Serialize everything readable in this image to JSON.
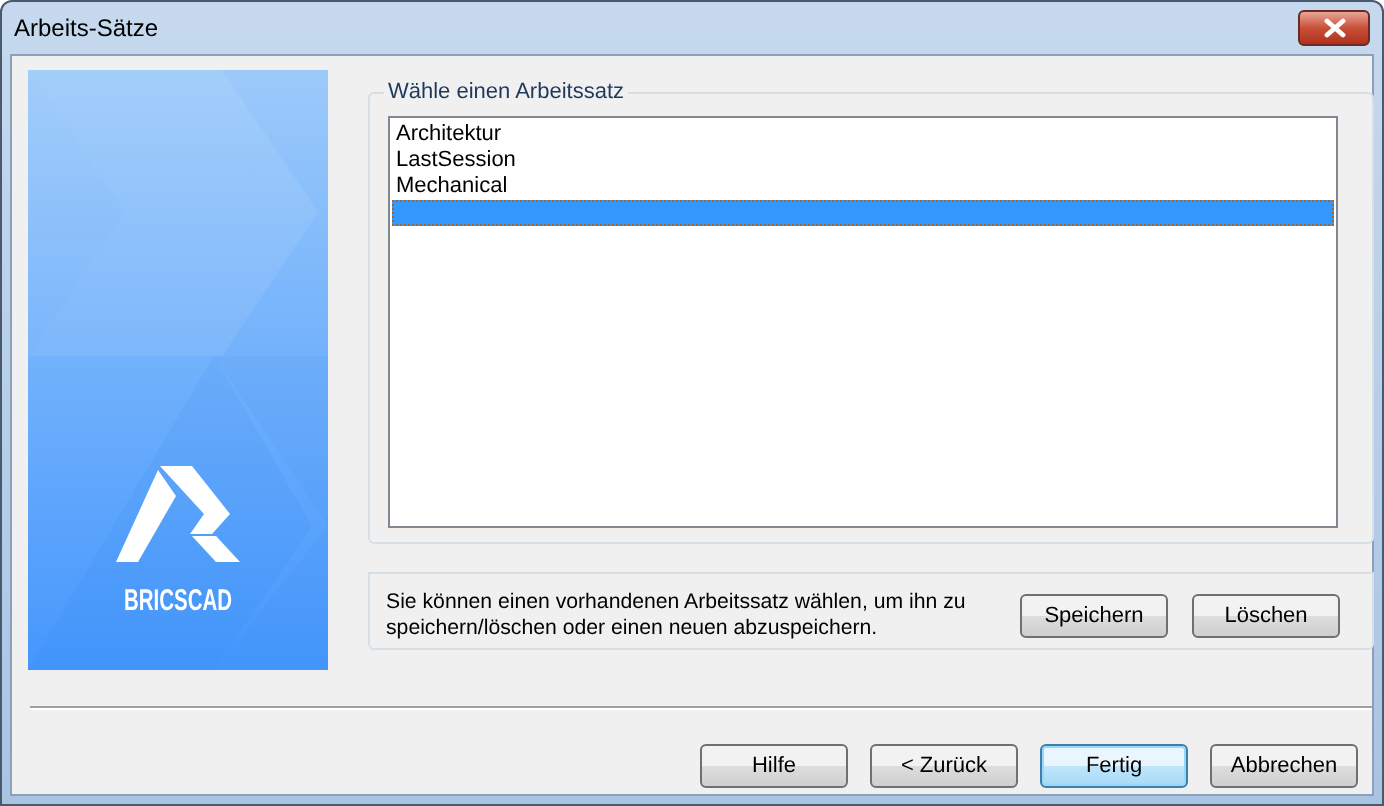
{
  "window": {
    "title": "Arbeits-Sätze"
  },
  "banner": {
    "logo_text": "BRICSCAD"
  },
  "group": {
    "legend": "Wähle einen Arbeitssatz",
    "items": [
      {
        "label": "Architektur",
        "selected": false
      },
      {
        "label": "LastSession",
        "selected": false
      },
      {
        "label": "Mechanical",
        "selected": false
      },
      {
        "selected": true
      }
    ]
  },
  "info": {
    "text": "Sie können einen vorhandenen Arbeitssatz wählen, um ihn zu speichern/löschen oder einen neuen abzuspeichern.",
    "buttons": [
      {
        "label": "Speichern"
      },
      {
        "label": "Löschen"
      }
    ]
  },
  "footer_buttons": [
    {
      "label": "Hilfe",
      "default": false
    },
    {
      "label": "< Zurück",
      "default": false
    },
    {
      "label": "Fertig",
      "default": true
    },
    {
      "label": "Abbrechen",
      "default": false
    }
  ]
}
